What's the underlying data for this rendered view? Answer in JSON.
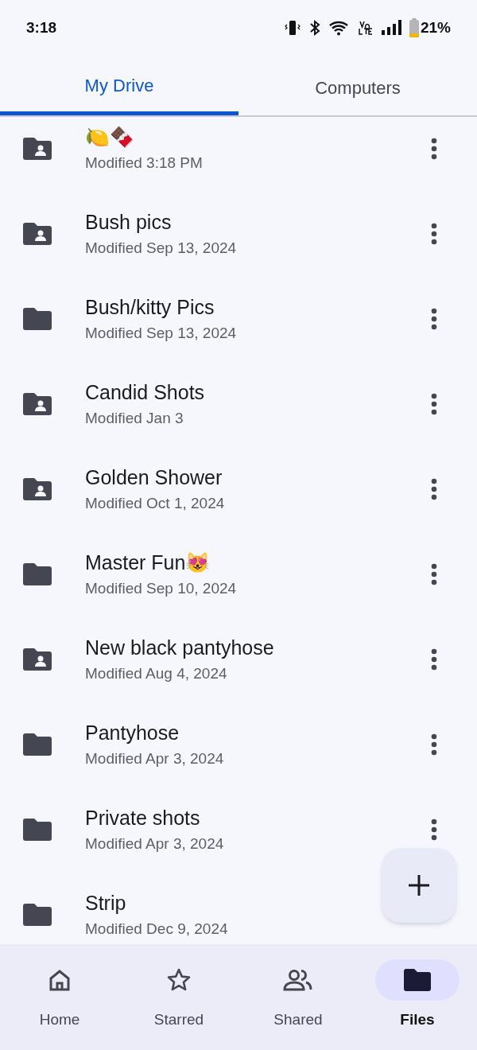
{
  "status_bar": {
    "time": "3:18",
    "battery": "21%"
  },
  "tabs": [
    {
      "label": "My Drive",
      "selected": true
    },
    {
      "label": "Computers",
      "selected": false
    }
  ],
  "files": [
    {
      "name": "🍋🍫",
      "modified": "Modified 3:18 PM",
      "kind": "shared"
    },
    {
      "name": "Bush pics",
      "modified": "Modified Sep 13, 2024",
      "kind": "shared"
    },
    {
      "name": "Bush/kitty Pics",
      "modified": "Modified Sep 13, 2024",
      "kind": "folder"
    },
    {
      "name": "Candid Shots",
      "modified": "Modified Jan 3",
      "kind": "shared"
    },
    {
      "name": "Golden Shower",
      "modified": "Modified Oct 1, 2024",
      "kind": "shared"
    },
    {
      "name": "Master Fun😻",
      "modified": "Modified Sep 10, 2024",
      "kind": "folder"
    },
    {
      "name": "New black pantyhose",
      "modified": "Modified Aug 4, 2024",
      "kind": "shared"
    },
    {
      "name": "Pantyhose",
      "modified": "Modified Apr 3, 2024",
      "kind": "folder"
    },
    {
      "name": "Private shots",
      "modified": "Modified Apr 3, 2024",
      "kind": "folder"
    },
    {
      "name": "Strip",
      "modified": "Modified Dec 9, 2024",
      "kind": "folder"
    }
  ],
  "nav": [
    {
      "label": "Home",
      "selected": false
    },
    {
      "label": "Starred",
      "selected": false
    },
    {
      "label": "Shared",
      "selected": false
    },
    {
      "label": "Files",
      "selected": true
    }
  ]
}
